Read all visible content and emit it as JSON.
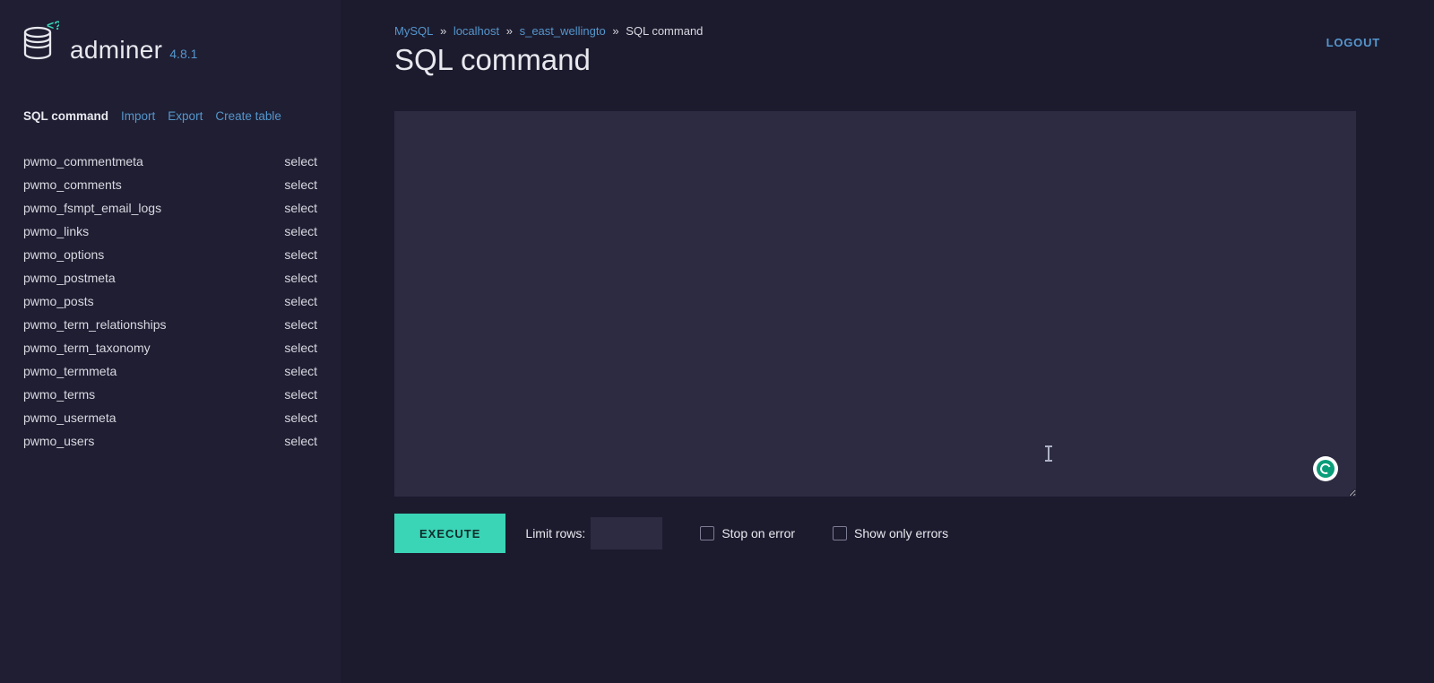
{
  "brand": {
    "name": "adminer",
    "version": "4.8.1"
  },
  "sidebar": {
    "actions": [
      {
        "label": "SQL command",
        "active": true
      },
      {
        "label": "Import",
        "active": false
      },
      {
        "label": "Export",
        "active": false
      },
      {
        "label": "Create table",
        "active": false
      }
    ],
    "select_label": "select",
    "tables": [
      "pwmo_commentmeta",
      "pwmo_comments",
      "pwmo_fsmpt_email_logs",
      "pwmo_links",
      "pwmo_options",
      "pwmo_postmeta",
      "pwmo_posts",
      "pwmo_term_relationships",
      "pwmo_term_taxonomy",
      "pwmo_termmeta",
      "pwmo_terms",
      "pwmo_usermeta",
      "pwmo_users"
    ]
  },
  "breadcrumb": {
    "items": [
      "MySQL",
      "localhost",
      "s_east_wellingto"
    ],
    "current": "SQL command"
  },
  "header": {
    "logout": "LOGOUT",
    "title": "SQL command"
  },
  "form": {
    "sql_value": "",
    "execute_label": "EXECUTE",
    "limit_label": "Limit rows:",
    "limit_value": "",
    "stop_on_error_label": "Stop on error",
    "show_only_errors_label": "Show only errors"
  }
}
